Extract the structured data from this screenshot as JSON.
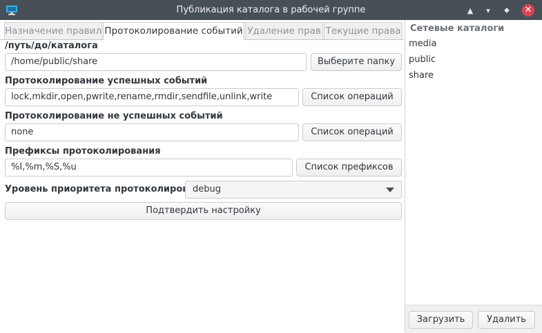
{
  "window": {
    "title": "Публикация каталога в рабочей группе",
    "icon": "folder-network-icon",
    "controls": [
      "keep-above-icon",
      "minimize-icon",
      "maximize-icon",
      "close-icon"
    ]
  },
  "tabs": [
    {
      "label": "Назначение правил",
      "active": false
    },
    {
      "label": "Протоколирование событий",
      "active": true
    },
    {
      "label": "Удаление прав",
      "active": false
    },
    {
      "label": "Текущие права",
      "active": false
    }
  ],
  "form": {
    "path": {
      "label": "/путь/до/каталога",
      "value": "/home/public/share",
      "button": "Выберите папку"
    },
    "success": {
      "label": "Протоколирование успешных событий",
      "value": "lock,mkdir,open,pwrite,rename,rmdir,sendfile,unlink,write",
      "button": "Список операций"
    },
    "failure": {
      "label": "Протоколирование не успешных событий",
      "value": "none",
      "button": "Список операций"
    },
    "prefixes": {
      "label": "Префиксы протоколирования",
      "value": "%I,%m,%S,%u",
      "button": "Список префиксов"
    },
    "priority": {
      "label": "Уровень приоритета протоколирования",
      "value": "debug"
    },
    "confirm_button": "Подтвердить настройку"
  },
  "sidebar": {
    "header": "Сетевые каталоги",
    "items": [
      "media",
      "public",
      "share"
    ],
    "load_button": "Загрузить",
    "delete_button": "Удалить"
  },
  "colors": {
    "titlebar": "#475057",
    "close": "#da4453",
    "accent": "#3daee9"
  }
}
